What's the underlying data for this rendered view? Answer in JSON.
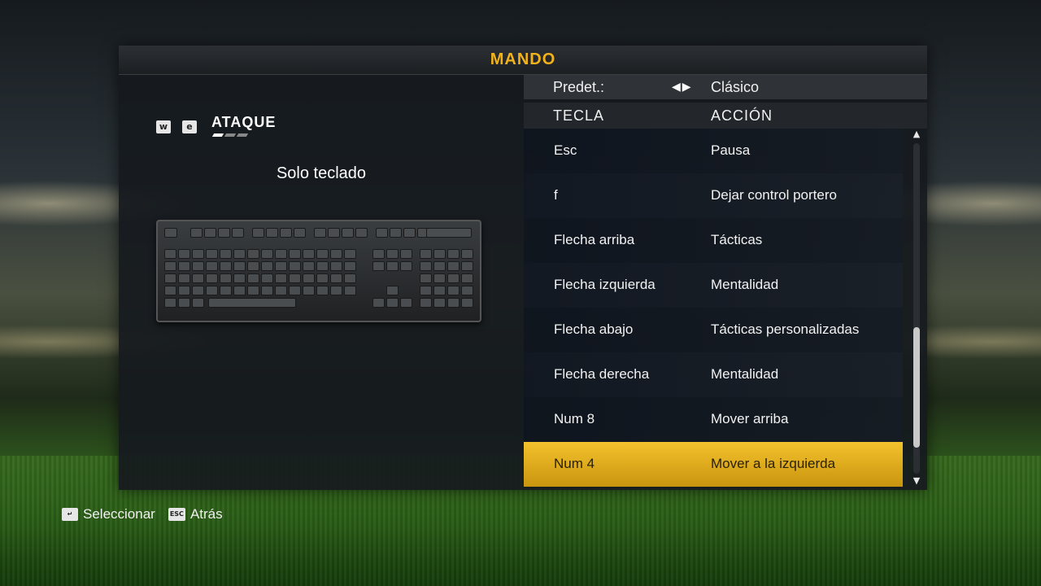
{
  "screen": {
    "title": "MANDO"
  },
  "left": {
    "badges": [
      "w",
      "e"
    ],
    "section_title": "ATAQUE",
    "mode_label": "Solo teclado"
  },
  "right": {
    "preset_label": "Predet.:",
    "preset_value": "Clásico",
    "columns": {
      "key": "TECLA",
      "action": "ACCIÓN"
    },
    "rows": [
      {
        "key": "Esc",
        "action": "Pausa"
      },
      {
        "key": "f",
        "action": "Dejar control portero"
      },
      {
        "key": "Flecha arriba",
        "action": "Tácticas"
      },
      {
        "key": "Flecha izquierda",
        "action": "Mentalidad"
      },
      {
        "key": "Flecha abajo",
        "action": "Tácticas personalizadas"
      },
      {
        "key": "Flecha derecha",
        "action": "Mentalidad"
      },
      {
        "key": "Num 8",
        "action": "Mover arriba"
      },
      {
        "key": "Num 4",
        "action": "Mover a la izquierda"
      }
    ],
    "selected_index": 7
  },
  "footer": {
    "select_icon": "enter-key-icon",
    "select_label": "Seleccionar",
    "back_icon": "esc-key-icon",
    "back_icon_text": "ESC",
    "back_label": "Atrás"
  },
  "colors": {
    "accent": "#f2b21b",
    "selected_row": "#e8b320",
    "panel": "#1a1e22"
  }
}
